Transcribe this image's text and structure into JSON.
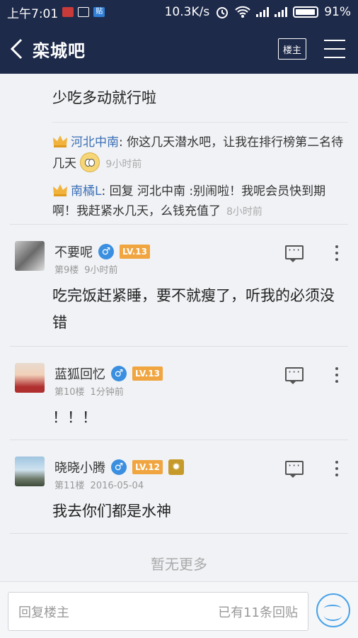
{
  "status_bar": {
    "time": "上午7:01",
    "speed": "10.3K/s",
    "battery": "91%",
    "sb_badge_3": "贴"
  },
  "nav": {
    "title": "栾城吧",
    "louzhu_button": "楼主"
  },
  "partial_post": {
    "text": "少吃多动就行啦"
  },
  "replies": [
    {
      "name": "河北中南",
      "text": ": 你这几天潜水吧，让我在排行榜第二名待几天",
      "time": "9小时前",
      "emoji": "pleading-face"
    },
    {
      "name": "南橘L",
      "text": ": 回复 河北中南 :别闹啦！我呢会员快到期啊！我赶紧水几天，么钱充值了",
      "time": "8小时前"
    }
  ],
  "posts": [
    {
      "username": "不要呢",
      "level": "LV.13",
      "floor": "第9楼",
      "time": "9小时前",
      "text": "吃完饭赶紧睡，要不就瘦了，听我的必须没错",
      "gender": "male"
    },
    {
      "username": "蓝狐回忆",
      "level": "LV.13",
      "floor": "第10楼",
      "time": "1分钟前",
      "text": "！！！",
      "gender": "male"
    },
    {
      "username": "晓晓小腾",
      "level": "LV.12",
      "floor": "第11楼",
      "time": "2016-05-04",
      "text": "我去你们都是水神",
      "gender": "male"
    }
  ],
  "footer": {
    "no_more": "暂无更多"
  },
  "bottom_bar": {
    "placeholder": "回复楼主",
    "reply_count": "已有11条回贴"
  },
  "colors": {
    "nav_bg": "#1e2a4a",
    "link_blue": "#3b6fb6",
    "level_orange": "#f0a540",
    "male_blue": "#3b8fe0",
    "smile_blue": "#4aa3e8"
  }
}
